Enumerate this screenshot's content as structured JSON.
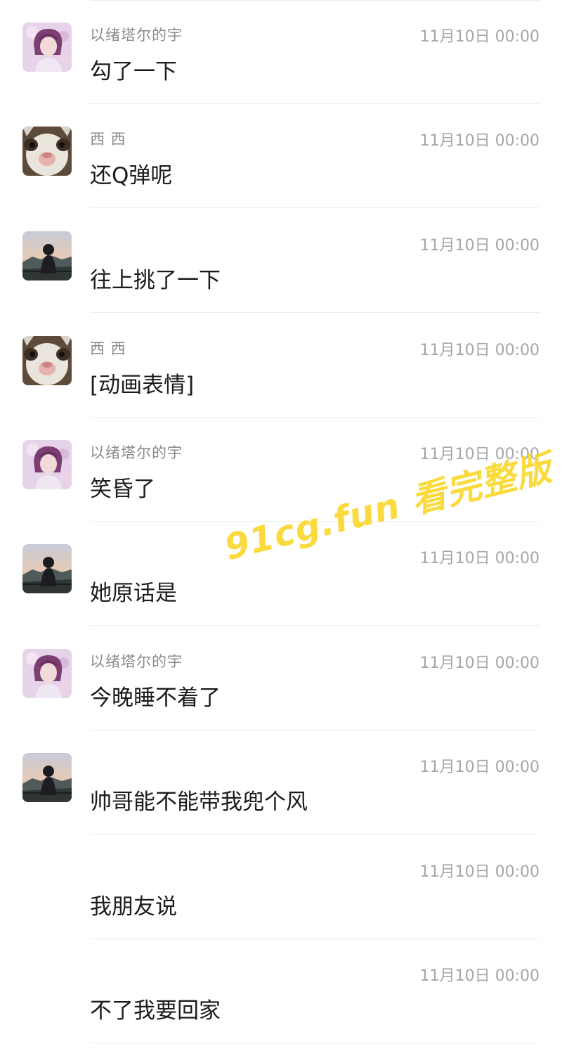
{
  "messages": [
    {
      "avatar": "anime-girl-avatar",
      "sender": "以绪塔尔的宇",
      "time": "11月10日 00:00",
      "text": "勾了一下"
    },
    {
      "avatar": "cat-face-avatar",
      "sender": "西 西",
      "time": "11月10日 00:00",
      "text": "还Q弹呢"
    },
    {
      "avatar": "mountain-person-avatar",
      "sender": "",
      "time": "11月10日 00:00",
      "text": "往上挑了一下"
    },
    {
      "avatar": "cat-face-avatar",
      "sender": "西 西",
      "time": "11月10日 00:00",
      "text": "[动画表情]"
    },
    {
      "avatar": "anime-girl-avatar",
      "sender": "以绪塔尔的宇",
      "time": "11月10日 00:00",
      "text": "笑昏了"
    },
    {
      "avatar": "mountain-person-avatar",
      "sender": "",
      "time": "11月10日 00:00",
      "text": "她原话是"
    },
    {
      "avatar": "anime-girl-avatar",
      "sender": "以绪塔尔的宇",
      "time": "11月10日 00:00",
      "text": "今晚睡不着了"
    },
    {
      "avatar": "mountain-person-avatar",
      "sender": "",
      "time": "11月10日 00:00",
      "text": "帅哥能不能带我兜个风"
    },
    {
      "avatar": "",
      "sender": "",
      "time": "11月10日 00:00",
      "text": "我朋友说"
    },
    {
      "avatar": "",
      "sender": "",
      "time": "11月10日 00:00",
      "text": "不了我要回家"
    }
  ],
  "watermark": "91cg.fun 看完整版",
  "colors": {
    "watermark": "#fad628",
    "sender": "#8a8a8a",
    "time": "#a6a6a6",
    "text": "#1c1c1c"
  }
}
